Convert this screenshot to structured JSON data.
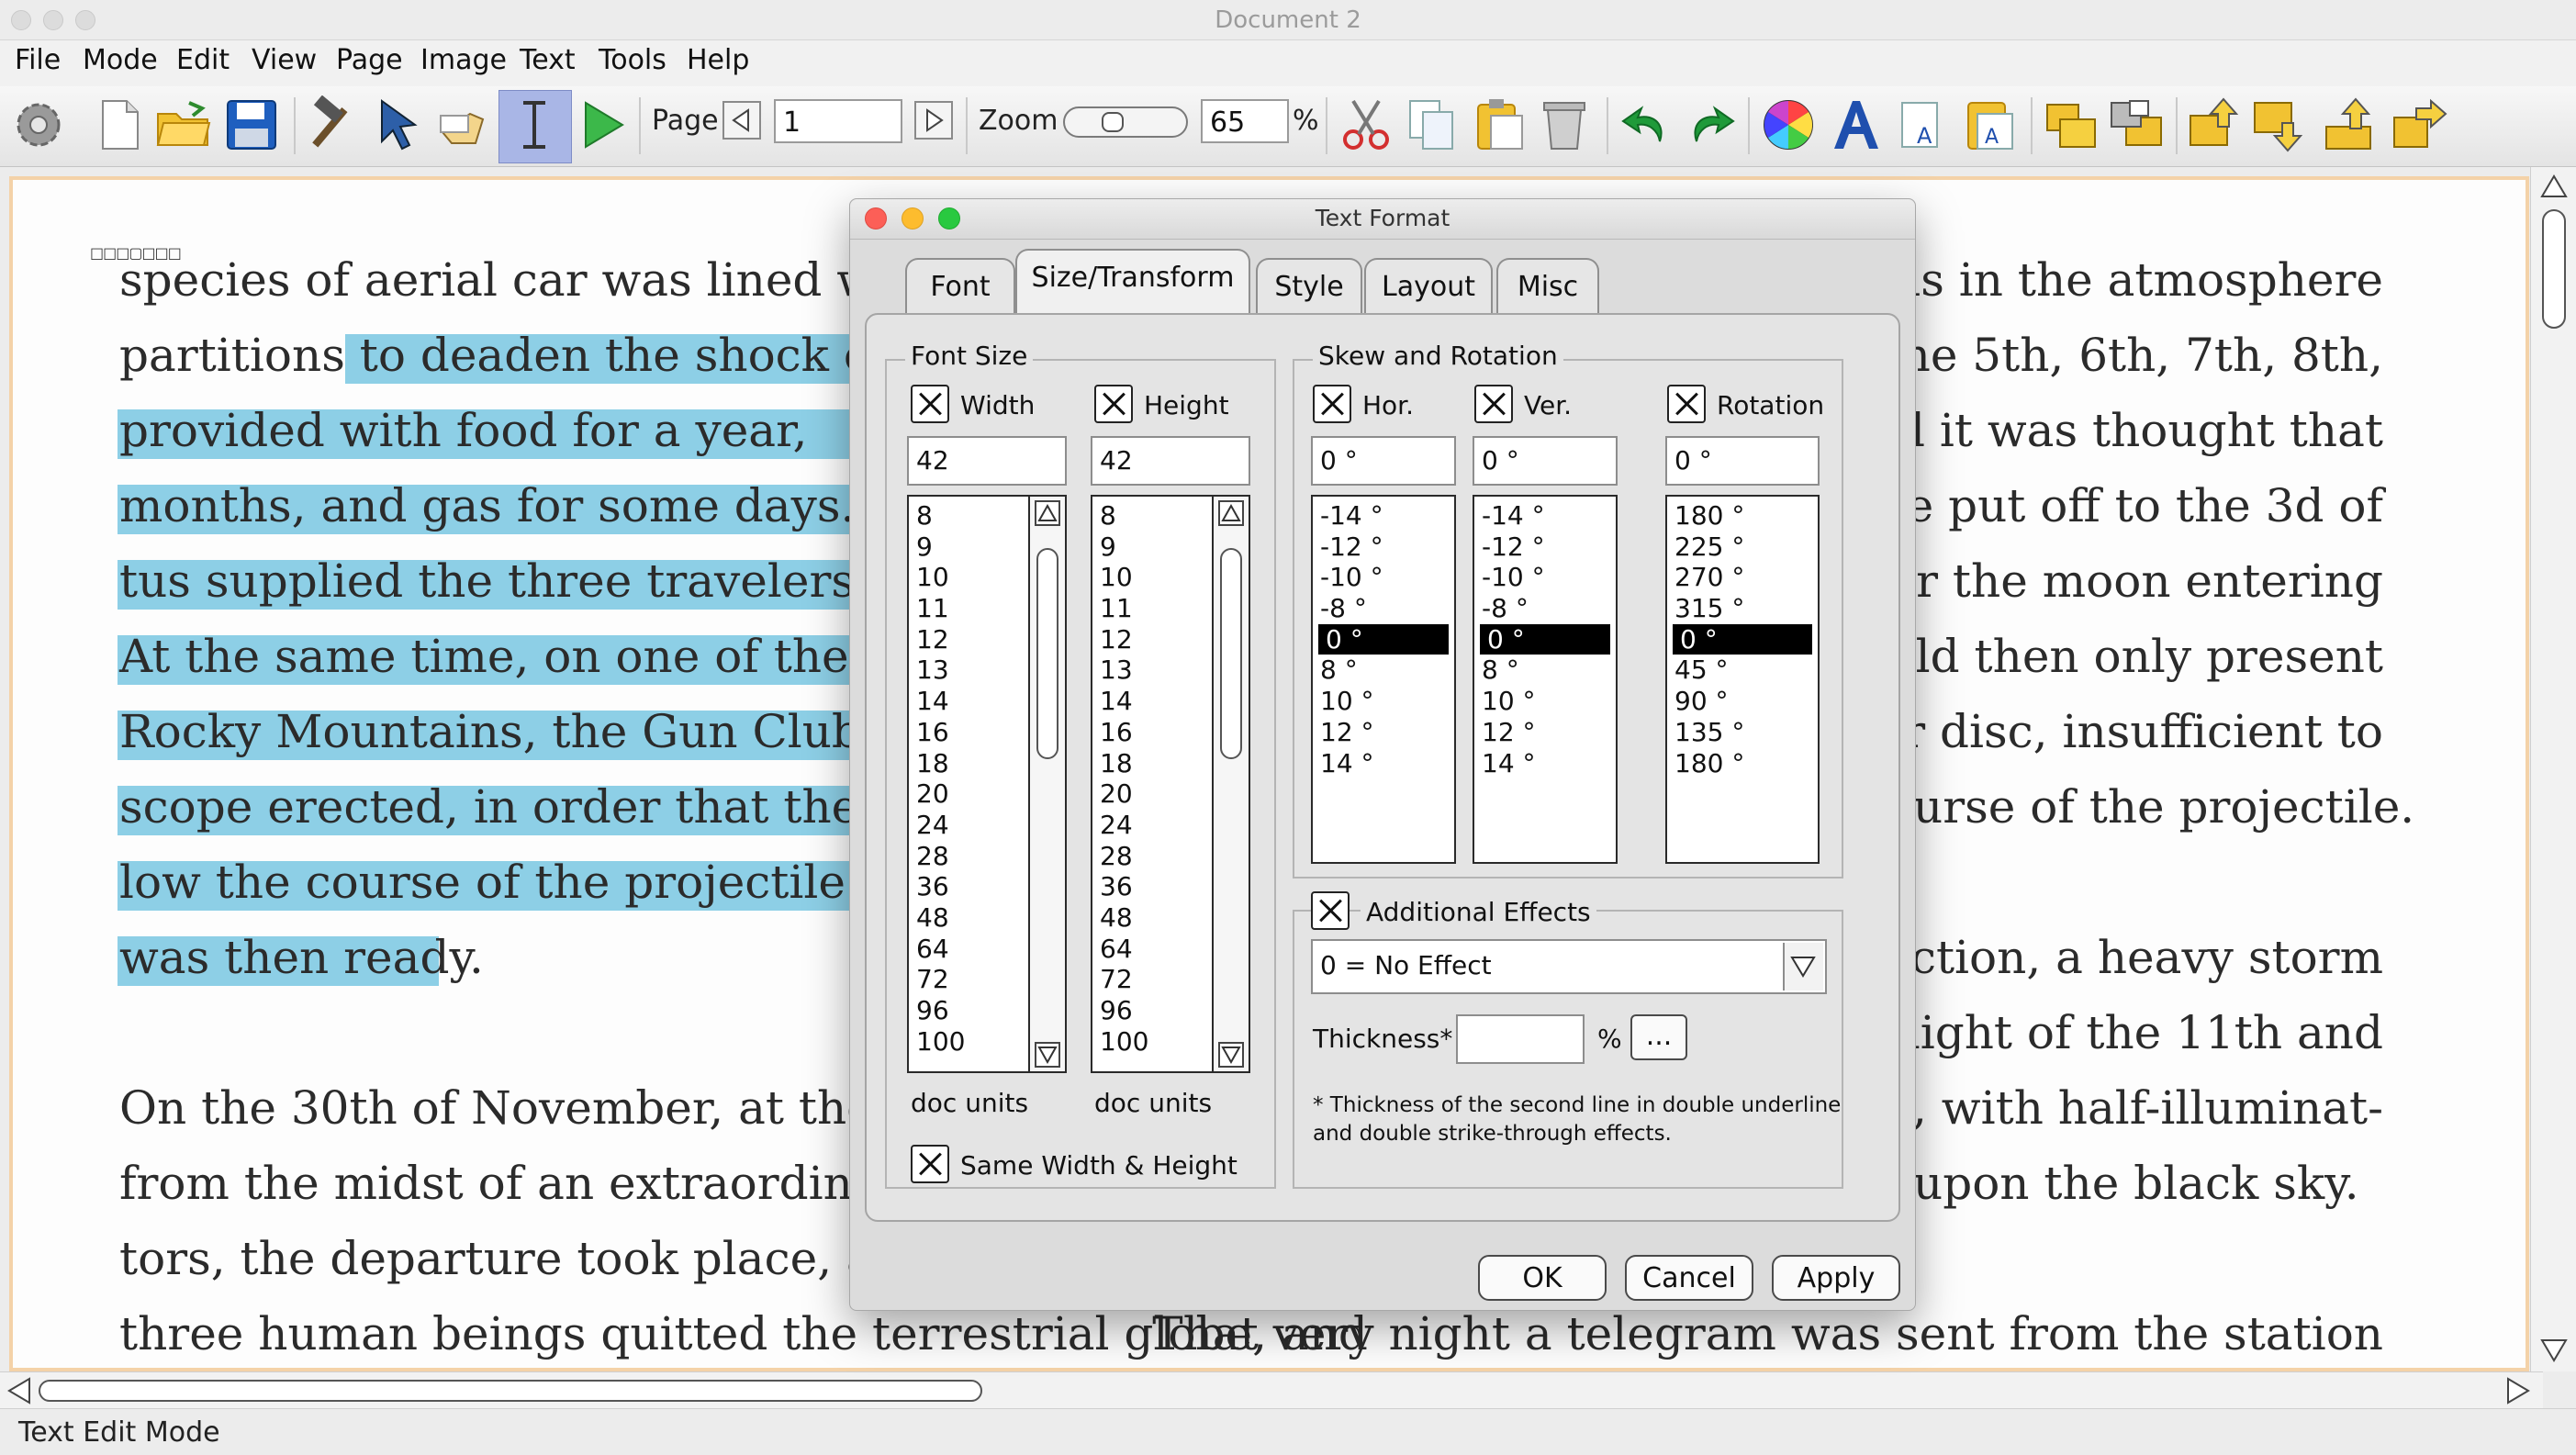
{
  "window": {
    "title": "Document 2"
  },
  "menubar": {
    "items": [
      "File",
      "Mode",
      "Edit",
      "View",
      "Page",
      "Image",
      "Text",
      "Tools",
      "Help"
    ]
  },
  "toolbar": {
    "page_label": "Page",
    "page_value": "1",
    "zoom_label": "Zoom",
    "zoom_value": "65",
    "zoom_unit": "%"
  },
  "document": {
    "left_lines": [
      "species of aerial car was lined with s",
      "partitions to deaden the shock of",
      "provided with food for a year,",
      "months, and gas for some days. A s",
      "tus supplied the three travelers wi",
      "At the same time, on one of the hig",
      "Rocky Mountains, the Gun Club ha",
      "scope erected, in order that they m",
      "low the course of the projectile tl",
      "was then ready.",
      "On the 30th of November, at the",
      "from the midst of an extraordinary",
      "tors, the departure took place, and",
      "three human beings quitted the terrestrial globe, and"
    ],
    "right_lines": [
      "uds in the atmosphere",
      "the 5th, 6th, 7th, 8th,",
      "eed it was thought that",
      "be put off to the 3d of",
      "for the moon entering",
      "ould then only present",
      "her disc, insufficient to",
      "urse of the projectile.",
      "faction, a heavy storm",
      "e night of the 11th and",
      "on, with half-illuminat-",
      "upon the black sky.",
      "That very night a telegram was sent from the station"
    ],
    "highlight_color": "#8dcfe6"
  },
  "status_bar": {
    "text": "Text Edit Mode"
  },
  "dialog": {
    "title": "Text Format",
    "tabs": [
      "Font",
      "Size/Transform",
      "Style",
      "Layout",
      "Misc"
    ],
    "active_tab": "Size/Transform",
    "font_size": {
      "group_title": "Font Size",
      "width_label": "Width",
      "height_label": "Height",
      "width_value": "42",
      "height_value": "42",
      "sizes": [
        "8",
        "9",
        "10",
        "11",
        "12",
        "13",
        "14",
        "16",
        "18",
        "20",
        "24",
        "28",
        "36",
        "48",
        "64",
        "72",
        "96",
        "100"
      ],
      "units_label": "doc units",
      "same_label": "Same Width & Height"
    },
    "skew": {
      "group_title": "Skew and Rotation",
      "hor_label": "Hor.",
      "ver_label": "Ver.",
      "rot_label": "Rotation",
      "hor_value": "0 °",
      "ver_value": "0 °",
      "rot_value": "0 °",
      "skew_values": [
        "-14 °",
        "-12 °",
        "-10 °",
        "-8 °",
        "0 °",
        "8 °",
        "10 °",
        "12 °",
        "14 °"
      ],
      "rot_values": [
        "180 °",
        "225 °",
        "270 °",
        "315 °",
        "0 °",
        "45 °",
        "90 °",
        "135 °",
        "180 °"
      ],
      "selected": "0 °"
    },
    "effects": {
      "label": "Additional Effects",
      "selected": "0 = No Effect",
      "thickness_label": "Thickness*",
      "thickness_value": "",
      "thickness_unit": "%",
      "browse_label": "...",
      "note_line1": "* Thickness of the second line in double underline",
      "note_line2": "and double strike-through effects."
    },
    "buttons": {
      "ok": "OK",
      "cancel": "Cancel",
      "apply": "Apply"
    }
  },
  "colors": {
    "accent_orange": "#f4d2a8",
    "close": "#fc5f57",
    "minimize": "#fdbc2e",
    "zoom": "#29c940"
  }
}
